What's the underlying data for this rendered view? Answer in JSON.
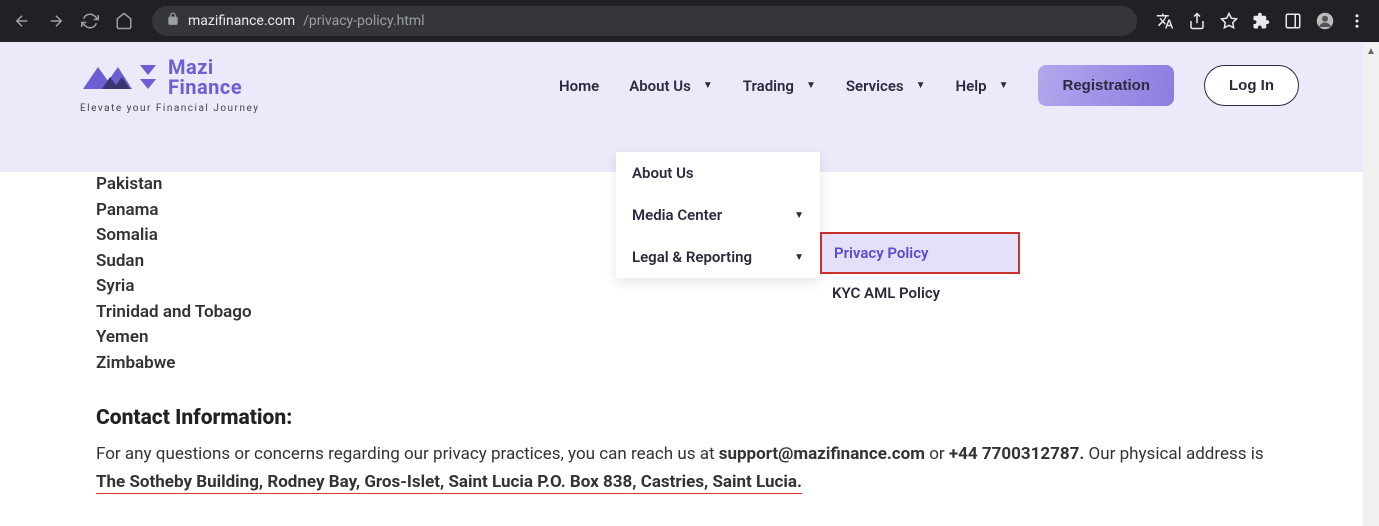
{
  "browser": {
    "url_domain": "mazifinance.com",
    "url_path": "/privacy-policy.html"
  },
  "header": {
    "brand_line1": "Mazi",
    "brand_line2": "Finance",
    "tagline": "Elevate your Financial Journey",
    "nav": {
      "home": "Home",
      "about": "About Us",
      "trading": "Trading",
      "services": "Services",
      "help": "Help"
    },
    "registration": "Registration",
    "login": "Log In"
  },
  "dropdown": {
    "about_us": "About Us",
    "media_center": "Media Center",
    "legal_reporting": "Legal & Reporting"
  },
  "sub_dropdown": {
    "privacy": "Privacy Policy",
    "kyc": "KYC AML Policy"
  },
  "countries": [
    "Pakistan",
    "Panama",
    "Somalia",
    "Sudan",
    "Syria",
    "Trinidad and Tobago",
    "Yemen",
    "Zimbabwe"
  ],
  "contact": {
    "heading": "Contact Information:",
    "text_before_email": "For any questions or concerns regarding our privacy practices, you can reach us at ",
    "email": "support@mazifinance.com",
    "or": " or ",
    "phone": "+44 7700312787.",
    "text_after_phone": " Our physical address is",
    "address": " The Sotheby Building, Rodney Bay, Gros-Islet, Saint Lucia P.O. Box 838, Castries, Saint Lucia. "
  }
}
